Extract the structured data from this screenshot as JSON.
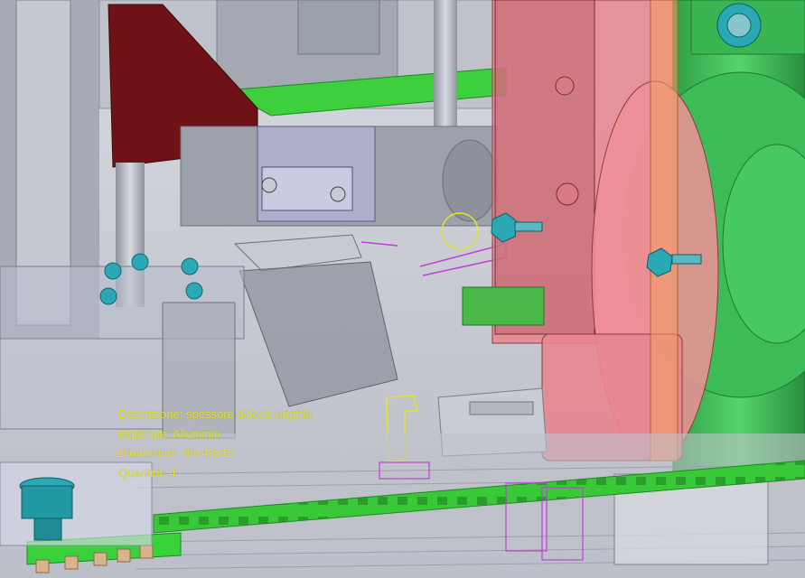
{
  "tooltip": {
    "descrizione": "Descrizione: spessore blocco cinghia",
    "materiale": "Materiale: Alluminio",
    "dimensioni": "Dimensioni: 80x43x15",
    "quantita": "Quantità: 4"
  },
  "colors": {
    "tooltip_text": "#e6e32a",
    "belt_green": "#3fd23f",
    "housing_pink": "#e8868f",
    "motor_green": "#3dbb56",
    "bolt_teal": "#2aa8b3",
    "maroon_block": "#6e1218",
    "selection_outline": "#e6e32a",
    "edge_magenta": "#c040d8"
  }
}
